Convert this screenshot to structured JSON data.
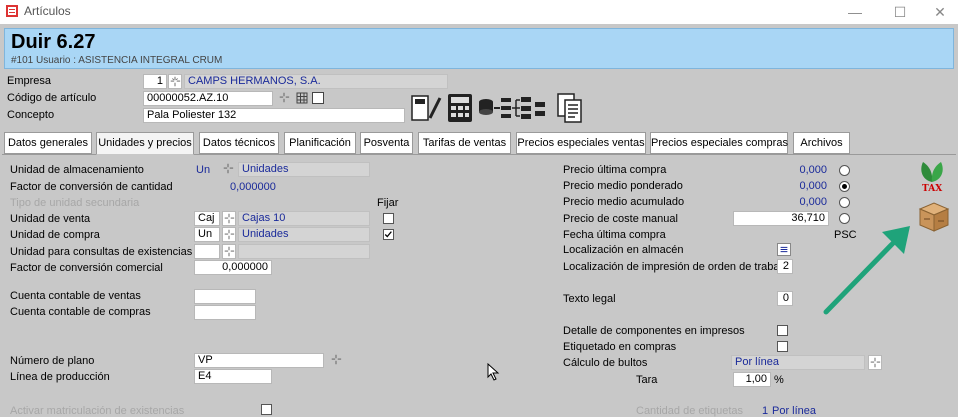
{
  "window": {
    "title": "Artículos"
  },
  "header": {
    "title": "Duir 6.27",
    "subtitle": "#101 Usuario : ASISTENCIA INTEGRAL CRUM"
  },
  "top_form": {
    "empresa_label": "Empresa",
    "empresa_code": "1",
    "empresa_name": "CAMPS HERMANOS, S.A.",
    "codigo_label": "Código de artículo",
    "codigo_value": "00000052.AZ.10",
    "concepto_label": "Concepto",
    "concepto_value": "Pala Poliester 132"
  },
  "tabs": [
    {
      "label": "Datos generales"
    },
    {
      "label": "Unidades y precios"
    },
    {
      "label": "Datos técnicos"
    },
    {
      "label": "Planificación"
    },
    {
      "label": "Posventa"
    },
    {
      "label": "Tarifas de ventas"
    },
    {
      "label": "Precios especiales ventas"
    },
    {
      "label": "Precios especiales compras"
    },
    {
      "label": "Archivos"
    }
  ],
  "active_tab": "Unidades y precios",
  "left": {
    "unidad_almacenamiento_label": "Unidad de almacenamiento",
    "unidad_almacenamiento_code": "Un",
    "unidad_almacenamiento_name": "Unidades",
    "factor_conversion_label": "Factor de conversión de cantidad",
    "factor_conversion_value": "0,000000",
    "tipo_unidad_secundaria_label": "Tipo de unidad secundaria",
    "fijar_label": "Fijar",
    "unidad_venta_label": "Unidad de venta",
    "unidad_venta_code": "Caj",
    "unidad_venta_name": "Cajas 10",
    "unidad_venta_fijar": false,
    "unidad_compra_label": "Unidad de compra",
    "unidad_compra_code": "Un",
    "unidad_compra_name": "Unidades",
    "unidad_compra_fijar": true,
    "unidad_consultas_label": "Unidad para consultas de existencias",
    "factor_comercial_label": "Factor de conversión comercial",
    "factor_comercial_value": "0,000000",
    "cuenta_ventas_label": "Cuenta contable de ventas",
    "cuenta_compras_label": "Cuenta contable de compras",
    "numero_plano_label": "Número de plano",
    "numero_plano_value": "VP",
    "linea_produccion_label": "Línea de producción",
    "linea_produccion_value": "E4",
    "matriculacion_label": "Activar matriculación de existencias"
  },
  "right": {
    "precio_ultima_compra_label": "Precio última compra",
    "precio_ultima_compra_value": "0,000",
    "precio_medio_ponderado_label": "Precio medio ponderado",
    "precio_medio_ponderado_value": "0,000",
    "precio_medio_acumulado_label": "Precio medio acumulado",
    "precio_medio_acumulado_value": "0,000",
    "precio_coste_manual_label": "Precio de coste manual",
    "precio_coste_manual_value": "36,710",
    "selected_price_option": "Precio medio ponderado",
    "psc_label": "PSC",
    "fecha_ultima_compra_label": "Fecha última compra",
    "localizacion_almacen_label": "Localización en almacén",
    "localizacion_impresion_label": "Localización de impresión de orden de trabajo",
    "localizacion_impresion_value": "2",
    "texto_legal_label": "Texto legal",
    "texto_legal_value": "0",
    "detalle_componentes_label": "Detalle de componentes en impresos",
    "etiquetado_compras_label": "Etiquetado en compras",
    "calculo_bultos_label": "Cálculo de bultos",
    "calculo_bultos_value": "Por línea",
    "tara_label": "Tara",
    "tara_value": "1,00",
    "tara_unit": "%",
    "cantidad_etiquetas_label": "Cantidad de etiquetas",
    "cantidad_etiquetas_code": "1",
    "cantidad_etiquetas_value": "Por línea"
  },
  "tax_icon": {
    "label": "TAX"
  },
  "colors": {
    "header_bg": "#a9d6f5",
    "value_blue": "#1a2a9a",
    "arrow_green": "#1fa37a"
  }
}
